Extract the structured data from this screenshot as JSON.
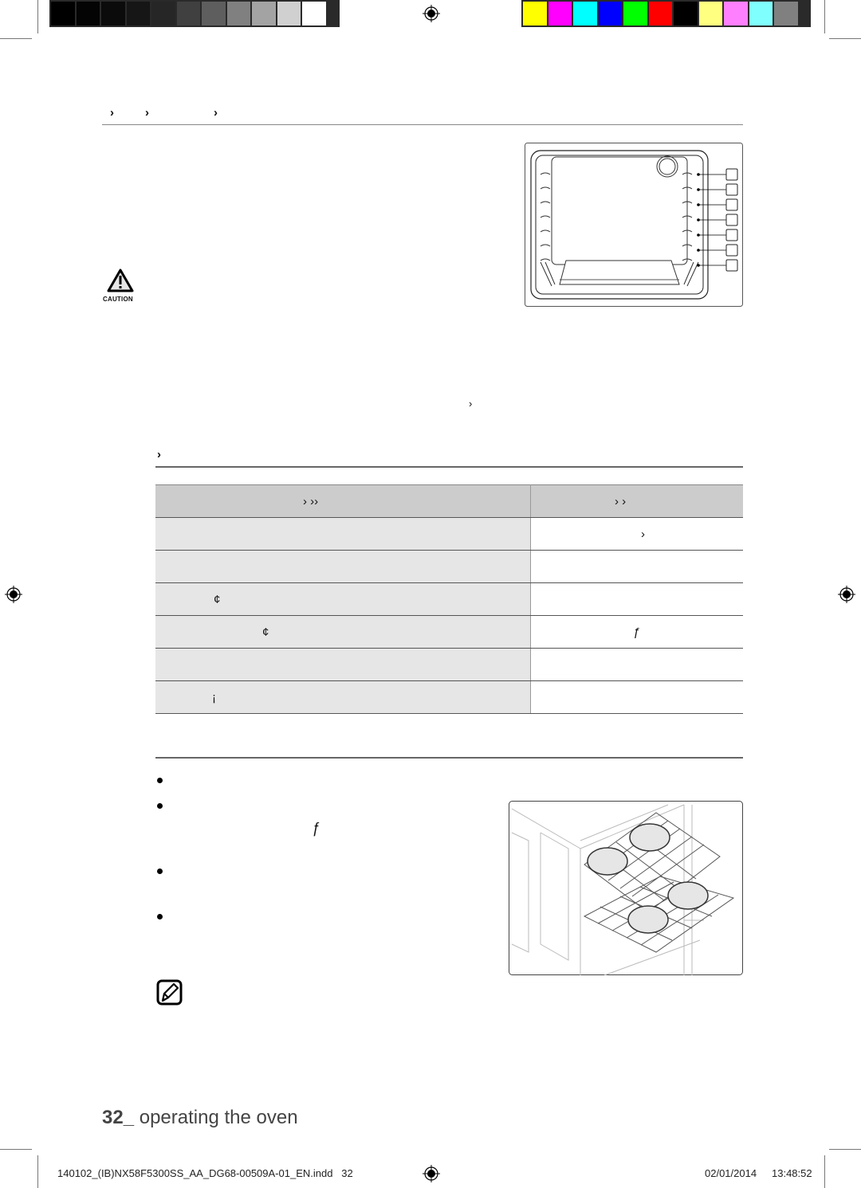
{
  "color_bars": {
    "grayscale": [
      "#000000",
      "#040404",
      "#0b0b0b",
      "#161616",
      "#262626",
      "#404040",
      "#5e5e5e",
      "#808080",
      "#a3a3a3",
      "#d0d0d0",
      "#ffffff"
    ],
    "colors": [
      "#ffff00",
      "#ff00ff",
      "#00ffff",
      "#0000ff",
      "#00ff00",
      "#ff0000",
      "#000000",
      "#ffff80",
      "#ff80ff",
      "#80ffff",
      "#808080"
    ]
  },
  "section_heading": {
    "glyphs": [
      "›",
      "›",
      "›"
    ]
  },
  "caution": {
    "label": "CAUTION",
    "icon": "warning-triangle-icon"
  },
  "oven_diagram": {
    "rack_positions": 7,
    "callout_labels": [
      "",
      "",
      "",
      "",
      "",
      "",
      ""
    ]
  },
  "body_glyph_1": "›",
  "subheading": {
    "glyph": "›"
  },
  "table": {
    "header": [
      "›  ››",
      "›   ›"
    ],
    "rows": [
      [
        "",
        "›"
      ],
      [
        "",
        ""
      ],
      [
        "¢",
        ""
      ],
      [
        "¢",
        "ƒ"
      ],
      [
        "",
        ""
      ],
      [
        "¡",
        ""
      ]
    ]
  },
  "bullets": [
    {
      "text": ""
    },
    {
      "text": "ƒ"
    },
    {
      "text": ""
    },
    {
      "text": ""
    }
  ],
  "note": {
    "icon": "note-pencil-icon"
  },
  "page_footer": {
    "page_number": "32_",
    "title": "operating the oven"
  },
  "slug": {
    "filename": "140102_(IB)NX58F5300SS_AA_DG68-00509A-01_EN.indd   32",
    "date": "02/01/2014",
    "time": "13:48:52"
  }
}
